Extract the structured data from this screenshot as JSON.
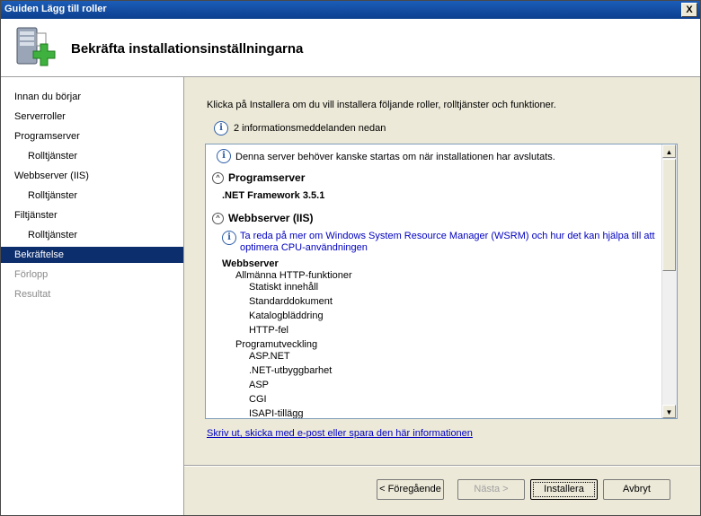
{
  "window": {
    "title": "Guiden Lägg till roller",
    "close_label": "X"
  },
  "header": {
    "title": "Bekräfta installationsinställningarna",
    "icon": "server-add-role-icon"
  },
  "sidebar": {
    "items": [
      {
        "label": "Innan du börjar"
      },
      {
        "label": "Serverroller"
      },
      {
        "label": "Programserver"
      },
      {
        "label": "Rolltjänster"
      },
      {
        "label": "Webbserver (IIS)"
      },
      {
        "label": "Rolltjänster"
      },
      {
        "label": "Filtjänster"
      },
      {
        "label": "Rolltjänster"
      },
      {
        "label": "Bekräftelse"
      },
      {
        "label": "Förlopp"
      },
      {
        "label": "Resultat"
      }
    ]
  },
  "main": {
    "instruction": "Klicka på Installera om du vill installera följande roller, rolltjänster och funktioner.",
    "info_count": "2 informationsmeddelanden nedan",
    "list": {
      "restart_notice": "Denna server behöver kanske startas om när installationen har avslutats.",
      "section1_title": "Programserver",
      "section1_item": ".NET Framework 3.5.1",
      "section2_title": "Webbserver (IIS)",
      "wsrm_link_line1": "Ta reda på mer om Windows System Resource Manager (WSRM) och hur det kan hjälpa till att",
      "wsrm_link_line2": "optimera CPU-användningen",
      "group_title": "Webbserver",
      "sub1": "Allmänna HTTP-funktioner",
      "sub1_items": [
        "Statiskt innehåll",
        "Standarddokument",
        "Katalogbläddring",
        "HTTP-fel"
      ],
      "sub2": "Programutveckling",
      "sub2_items": [
        "ASP.NET",
        ".NET-utbyggbarhet",
        "ASP",
        "CGI",
        "ISAPI-tillägg"
      ]
    },
    "print_link": "Skriv ut, skicka med e-post eller spara den här informationen"
  },
  "buttons": {
    "previous": "< Föregående",
    "next": "Nästa >",
    "install": "Installera",
    "cancel": "Avbryt"
  }
}
